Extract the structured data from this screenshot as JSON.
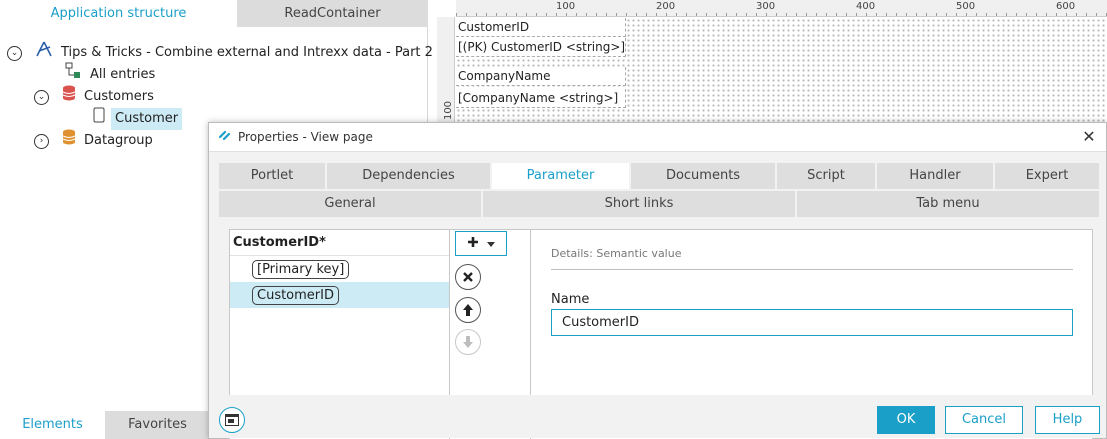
{
  "app": {
    "top_tabs": [
      {
        "label": "Application structure",
        "active": true
      },
      {
        "label": "ReadContainer",
        "active": false
      }
    ],
    "tree": {
      "root_label": "Tips & Tricks - Combine external and Intrexx data - Part 2",
      "all_entries_label": "All entries",
      "customers_label": "Customers",
      "customer_label": "Customer",
      "datagroup_label": "Datagroup"
    },
    "bottom_tabs": [
      {
        "label": "Elements",
        "active": true
      },
      {
        "label": "Favorites",
        "active": false
      }
    ]
  },
  "designer": {
    "ruler_h": [
      "100",
      "200",
      "300",
      "400",
      "500",
      "600"
    ],
    "ruler_v": [
      "100"
    ],
    "fields": {
      "f1": "CustomerID",
      "f2": "[(PK) CustomerID <string>]",
      "f3": "CompanyName",
      "f4": "[CompanyName <string>]"
    }
  },
  "dialog": {
    "title": "Properties - View page",
    "tabs_row1": [
      "Portlet",
      "Dependencies",
      "Parameter",
      "Documents",
      "Script",
      "Handler",
      "Expert"
    ],
    "active_tab": "Parameter",
    "tabs_row2": [
      "General",
      "Short links",
      "Tab menu"
    ],
    "list": {
      "header": "CustomerID*",
      "items": [
        "[Primary key]",
        "CustomerID"
      ],
      "selected_index": 1
    },
    "details": {
      "caption": "Details: Semantic value",
      "name_label": "Name",
      "name_value": "CustomerID"
    },
    "buttons": {
      "ok": "OK",
      "cancel": "Cancel",
      "help": "Help"
    }
  },
  "colors": {
    "accent": "#1a9fc9",
    "selection": "#cdebf5",
    "tab_inactive": "#dedede"
  },
  "icons": {
    "root": "app-icon",
    "all_entries": "tree-structure-icon",
    "customers": "database-icon",
    "customer": "page-icon",
    "datagroup": "database-icon",
    "add": "plus-icon",
    "delete": "x-circle-icon",
    "up": "arrow-up-icon",
    "down": "arrow-down-icon",
    "footer": "window-icon",
    "close": "close-icon"
  }
}
